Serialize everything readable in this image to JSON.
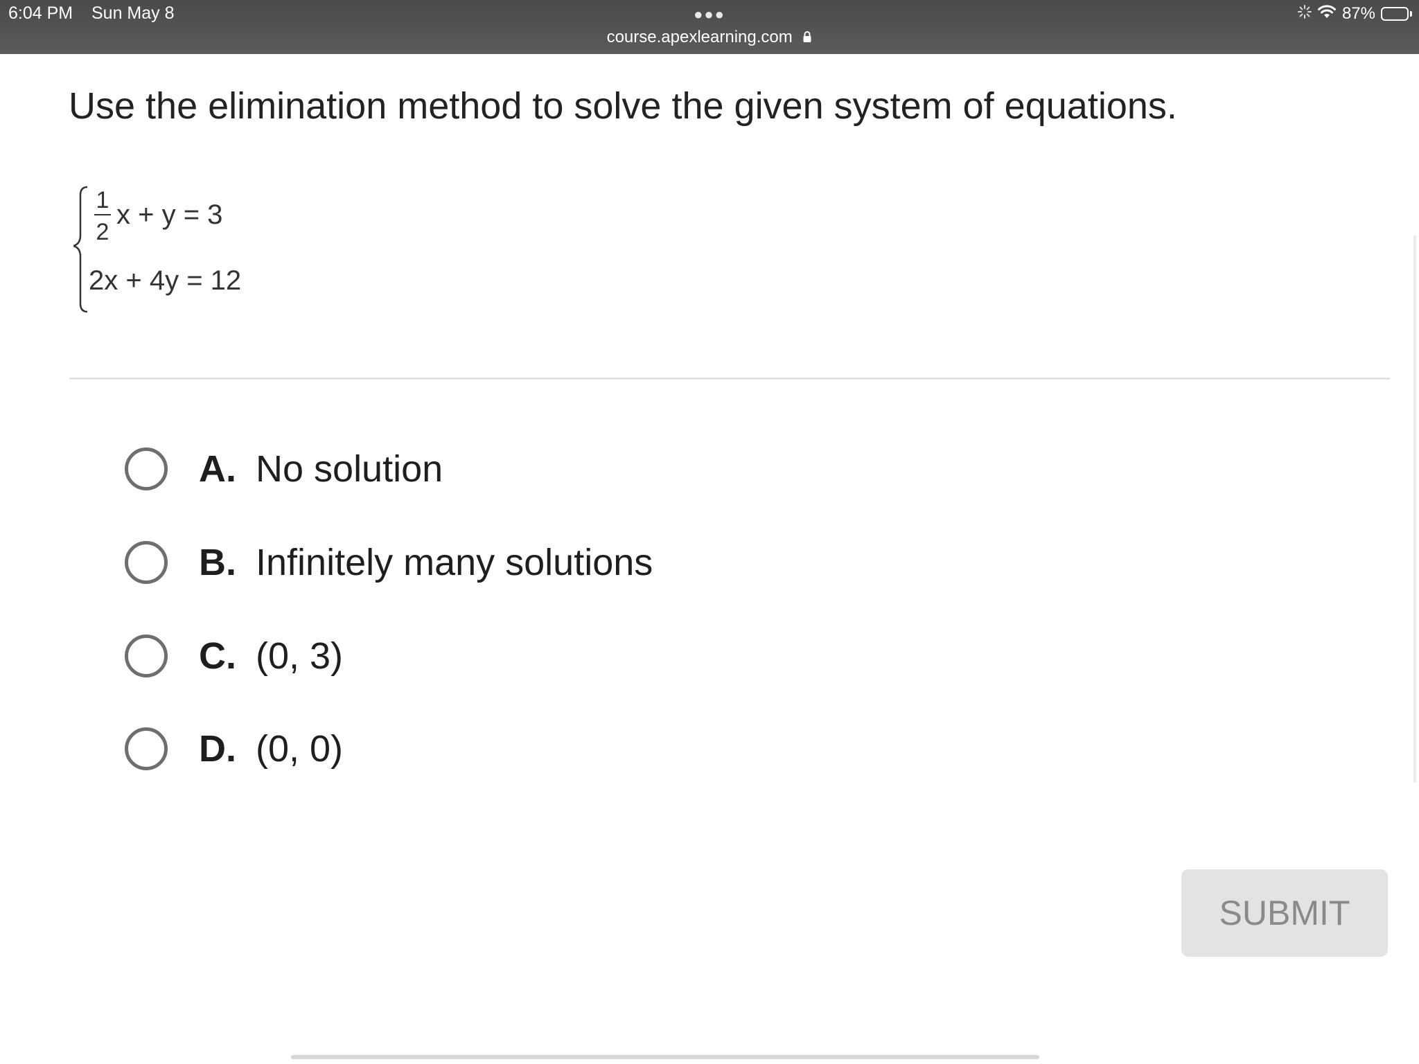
{
  "status_bar": {
    "time": "6:04 PM",
    "date": "Sun May 8",
    "battery": "87%",
    "battery_level": 0.87
  },
  "browser": {
    "url": "course.apexlearning.com"
  },
  "question": {
    "prompt": "Use the elimination method to solve the given system of equations.",
    "equations": {
      "eq1": {
        "fraction_numerator": "1",
        "fraction_denominator": "2",
        "rest": "x + y = 3"
      },
      "eq2": "2x + 4y = 12"
    }
  },
  "options": [
    {
      "letter": "A.",
      "text": "No solution"
    },
    {
      "letter": "B.",
      "text": "Infinitely many solutions"
    },
    {
      "letter": "C.",
      "text": "(0, 3)"
    },
    {
      "letter": "D.",
      "text": "(0, 0)"
    }
  ],
  "submit_label": "SUBMIT"
}
